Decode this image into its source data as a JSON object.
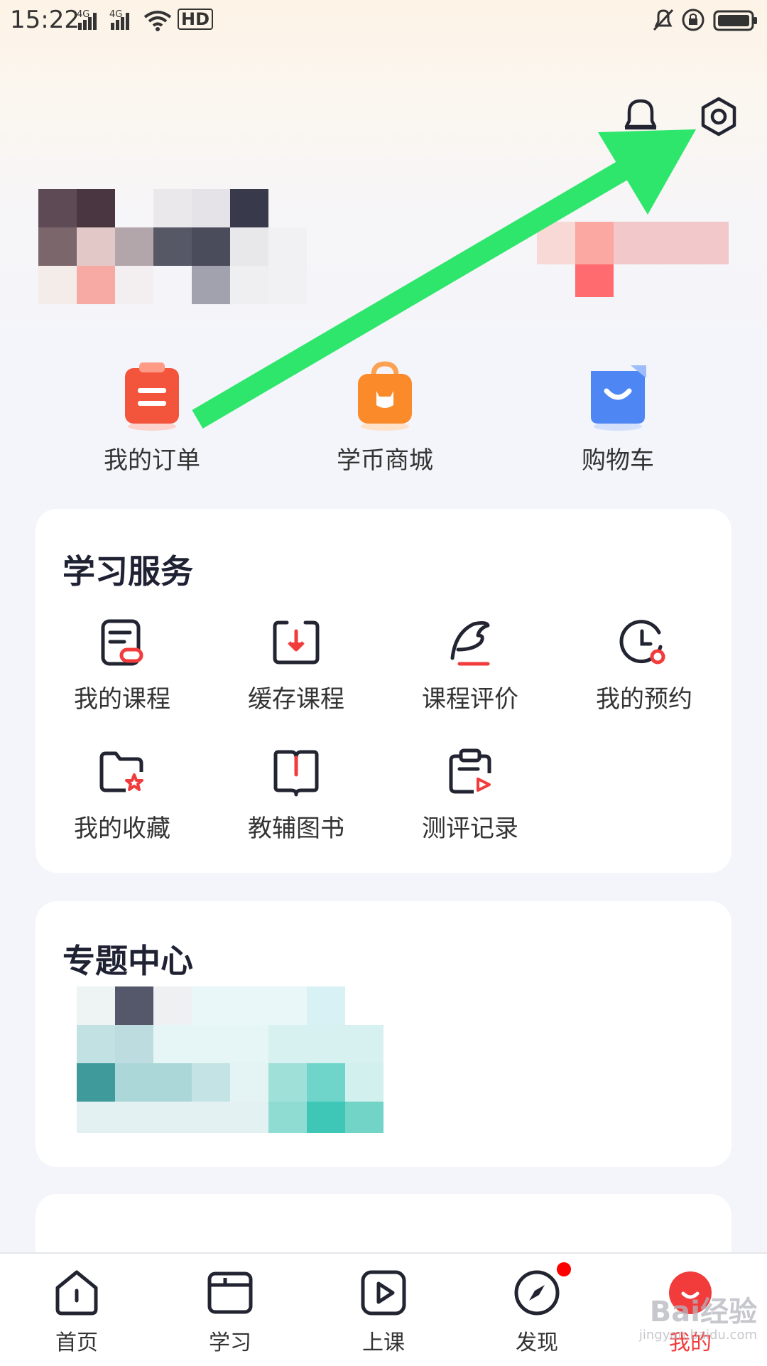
{
  "status_bar": {
    "time": "15:22",
    "network_1": "4G",
    "network_2": "4G",
    "hd_badge": "HD"
  },
  "header": {
    "icons": [
      "bell-icon",
      "settings-icon"
    ]
  },
  "quick_actions": [
    {
      "label": "我的订单",
      "icon": "order-icon",
      "color": "#f2553c"
    },
    {
      "label": "学币商城",
      "icon": "shop-bag-icon",
      "color": "#fb8a2a"
    },
    {
      "label": "购物车",
      "icon": "cart-icon",
      "color": "#4e86f4"
    }
  ],
  "study_services": {
    "title": "学习服务",
    "items": [
      {
        "label": "我的课程",
        "icon": "my-course-icon"
      },
      {
        "label": "缓存课程",
        "icon": "download-course-icon"
      },
      {
        "label": "课程评价",
        "icon": "feather-review-icon"
      },
      {
        "label": "我的预约",
        "icon": "clock-appointment-icon"
      },
      {
        "label": "我的收藏",
        "icon": "folder-star-icon"
      },
      {
        "label": "教辅图书",
        "icon": "book-icon"
      },
      {
        "label": "测评记录",
        "icon": "clipboard-record-icon"
      }
    ]
  },
  "topic_center": {
    "title": "专题中心"
  },
  "tab_bar": {
    "tabs": [
      {
        "label": "首页",
        "icon": "home-icon"
      },
      {
        "label": "学习",
        "icon": "study-book-icon"
      },
      {
        "label": "上课",
        "icon": "play-icon"
      },
      {
        "label": "发现",
        "icon": "compass-icon"
      },
      {
        "label": "我的",
        "icon": "profile-icon"
      }
    ],
    "active_color": "#f23b3b"
  },
  "watermark": {
    "text": "Bai经验",
    "subtext": "jingyan.baidu.com"
  },
  "colors": {
    "accent": "#f23b3b",
    "arrow": "#2ee66b",
    "icon_dark": "#222431"
  }
}
